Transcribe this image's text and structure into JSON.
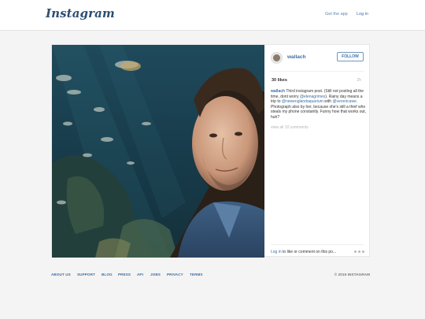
{
  "header": {
    "logo_text": "Instagram",
    "get_app": "Get the app",
    "login": "Log in"
  },
  "post": {
    "username": "wallach",
    "follow_label": "FOLLOW",
    "likes": "30 likes",
    "time_ago": "2h",
    "caption": {
      "user": "wallach",
      "t1": " Third instagram post. (Still not posting all the time, dont worry ",
      "m1": "@elenagrimes",
      "t2": "). Rainy day means a trip to ",
      "m2": "@newenglandaquarium",
      "t3": " with ",
      "m3": "@veronicawe",
      "t4": ". Photograph also by her, because she's still a thief who steals my phone constantly. Funny how that works out, huh?"
    },
    "view_all_comments": "view all 10 comments",
    "login_link": "Log in",
    "comment_prompt": " to like or comment on this po..."
  },
  "footer": {
    "links": [
      "ABOUT US",
      "SUPPORT",
      "BLOG",
      "PRESS",
      "API",
      "JOBS",
      "PRIVACY",
      "TERMS"
    ],
    "copyright": "© 2015 INSTAGRAM"
  },
  "icons": {
    "more": "more-options-icon"
  },
  "colors": {
    "link": "#3c6fa3",
    "logo": "#2b4e72",
    "background": "#f4f4f4"
  }
}
